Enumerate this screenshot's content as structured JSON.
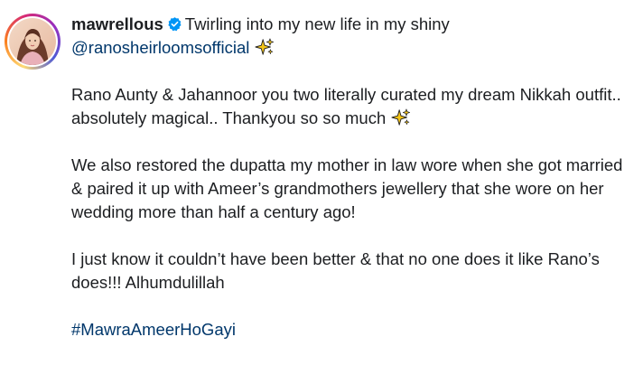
{
  "post": {
    "author": {
      "username": "mawrellous",
      "verified": true,
      "avatar_icon": "profile-photo-avatar",
      "story_ring_colors": [
        "#feda75",
        "#fa7e1e",
        "#d62976",
        "#962fbf",
        "#4f5bd5"
      ]
    },
    "caption": {
      "intro_text": "Twirling into my new life in my shiny",
      "mention": "@ranosheirloomsofficial",
      "paragraph_2": "Rano Aunty & Jahannoor you two literally curated my dream Nikkah outfit.. absolutely magical.. Thankyou so so much",
      "paragraph_3": "We also restored the dupatta my mother in law wore when she got married & paired it up with Ameer’s grandmothers jewellery that she wore on her wedding more than half a century ago!",
      "paragraph_4": "I just know it couldn’t have been better & that no one does it like Rano’s does!!! Alhumdulillah",
      "hashtag": "#MawraAmeerHoGayi"
    },
    "icons": {
      "verified": "verified-badge-icon",
      "sparkles": "sparkles-emoji-icon"
    },
    "colors": {
      "link": "#00376b",
      "verified": "#0095f6",
      "sparkle": "#f5c518",
      "text": "#1c1e21"
    }
  }
}
